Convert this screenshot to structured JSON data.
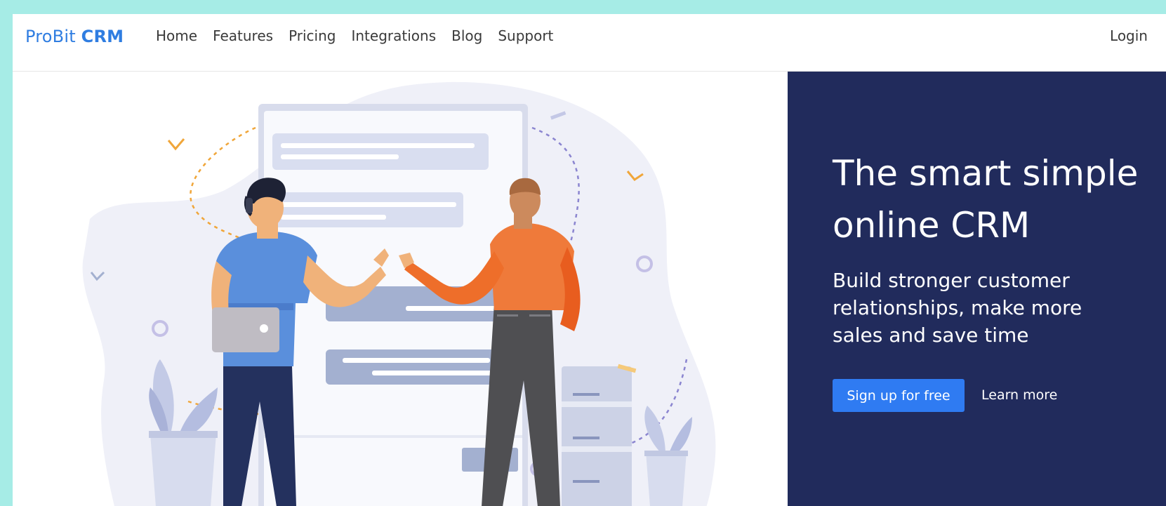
{
  "navbar": {
    "brand_light": "ProBit",
    "brand_bold": "CRM",
    "links": [
      "Home",
      "Features",
      "Pricing",
      "Integrations",
      "Blog",
      "Support"
    ],
    "login_label": "Login"
  },
  "hero": {
    "headline": "The smart simple online CRM",
    "subline": "Build stronger customer relationships, make more sales and save time",
    "primary_cta": "Sign up for free",
    "secondary_cta": "Learn more"
  },
  "colors": {
    "outer_background": "#a6ece6",
    "brand": "#2f7de1",
    "hero_panel": "#212b5c",
    "cta_primary": "#2f7bf2"
  },
  "illustration": {
    "subject": "two-people-conversation-illustration"
  }
}
